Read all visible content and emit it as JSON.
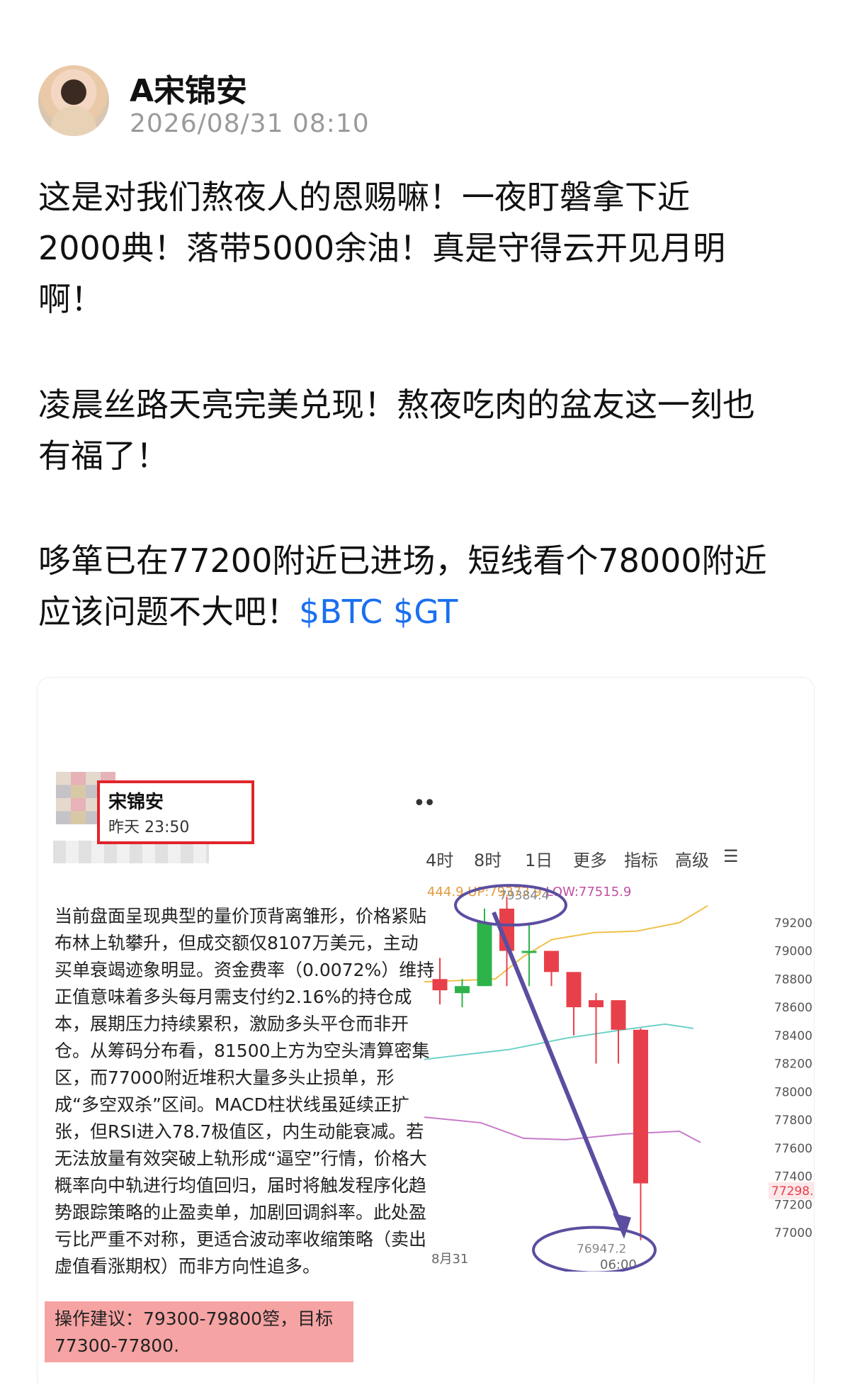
{
  "author": {
    "name": "A宋锦安",
    "time": "2026/08/31 08:10"
  },
  "post": {
    "line1": "这是对我们熬夜人的恩赐嘛！一夜盯磐拿下近",
    "line2": "2000典！落带5000余油！真是守得云开见月明",
    "line3": "啊！",
    "line4": "凌晨丝路天亮完美兑现！熬夜吃肉的盆友这一刻也",
    "line5": "有福了！",
    "line6": "哆箪已在77200附近已进场，短线看个78000附近",
    "line7_text": "应该问题不大吧！",
    "tags": [
      "$BTC",
      "$GT"
    ]
  },
  "card": {
    "author_name": "宋锦安",
    "author_time": "昨天 23:50",
    "analysis": "当前盘面呈现典型的量价顶背离雏形，价格紧贴\n布林上轨攀升，但成交额仅8107万美元，主动\n买单衰竭迹象明显。资金费率（0.0072%）维持\n正值意味着多头每月需支付约2.16%的持仓成\n本，展期压力持续累积，激励多头平仓而非开\n仓。从筹码分布看，81500上方为空头清算密集\n区，而77000附近堆积大量多头止损单，形\n成“多空双杀”区间。MACD柱状线虽延续正扩\n张，但RSI进入78.7极值区，内生动能衰减。若\n无法放量有效突破上轨形成“逼空”行情，价格大\n概率向中轨进行均值回归，届时将触发程序化趋\n势跟踪策略的止盈卖单，加剧回调斜率。此处盈\n亏比严重不对称，更适合波动率收缩策略（卖出\n虚值看涨期权）而非方向性追多。",
    "advice": "操作建议：79300-79800箜，目标\n77300-77800.",
    "tabs": [
      "4时",
      "8时",
      "1日",
      "更多",
      "指标",
      "高级"
    ],
    "stats": {
      "partial": "444.9",
      "up": "UP:79373.9",
      "low": "LOW:77515.9"
    }
  },
  "chart_data": {
    "type": "candlestick",
    "y_axis_ticks": [
      79200,
      79000,
      78800,
      78600,
      78400,
      78200,
      78000,
      77800,
      77600,
      77400,
      77200,
      77000
    ],
    "ylim": [
      76900,
      79400
    ],
    "x_labels": [
      "8月31",
      "06:00"
    ],
    "high_label": "79384.4",
    "low_label": "76947.2",
    "current_price": "77298.",
    "candles": [
      {
        "o": 78800,
        "h": 78950,
        "c": 78720,
        "l": 78620
      },
      {
        "o": 78700,
        "h": 78800,
        "c": 78750,
        "l": 78600
      },
      {
        "o": 78750,
        "h": 79300,
        "c": 79200,
        "l": 78750
      },
      {
        "o": 79300,
        "h": 79384.4,
        "c": 79000,
        "l": 78750
      },
      {
        "o": 79000,
        "h": 79200,
        "c": 79000,
        "l": 78750
      },
      {
        "o": 79000,
        "h": 79000,
        "c": 78850,
        "l": 78750
      },
      {
        "o": 78850,
        "h": 78850,
        "c": 78600,
        "l": 78400
      },
      {
        "o": 78650,
        "h": 78700,
        "c": 78600,
        "l": 78200
      },
      {
        "o": 78650,
        "h": 78650,
        "c": 78440,
        "l": 78200
      },
      {
        "o": 78440,
        "h": 78450,
        "c": 77350,
        "l": 76947.2
      }
    ],
    "colors": {
      "up": "#2db34a",
      "down": "#e8404a",
      "upper_band": "#f0c14b",
      "mid_band": "#6fd2c8",
      "lower_band": "#c77bc9",
      "annotation": "#5b4ea0"
    }
  }
}
